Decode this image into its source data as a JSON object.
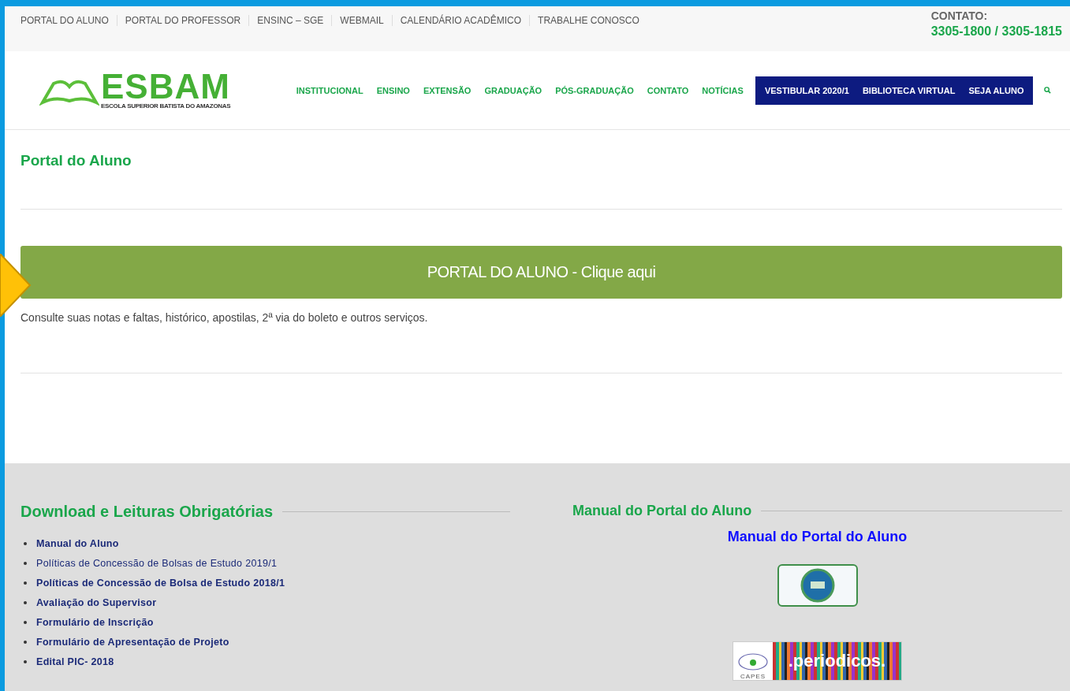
{
  "top_links": [
    "PORTAL DO ALUNO",
    "PORTAL DO PROFESSOR",
    "ENSINC – SGE",
    "WEBMAIL",
    "CALENDÁRIO ACADÊMICO",
    "TRABALHE CONOSCO"
  ],
  "contact": {
    "label": "CONTATO:",
    "phones": "3305-1800 / 3305-1815"
  },
  "logo": {
    "name": "ESBAM",
    "tagline": "ESCOLA SUPERIOR BATISTA DO AMAZONAS"
  },
  "nav": [
    {
      "label": "INSTITUCIONAL",
      "kind": "plain"
    },
    {
      "label": "ENSINO",
      "kind": "plain"
    },
    {
      "label": "EXTENSÃO",
      "kind": "plain"
    },
    {
      "label": "GRADUAÇÃO",
      "kind": "plain"
    },
    {
      "label": "PÓS-GRADUAÇÃO",
      "kind": "plain"
    },
    {
      "label": "CONTATO",
      "kind": "plain"
    },
    {
      "label": "NOTÍCIAS",
      "kind": "plain"
    },
    {
      "label": "VESTIBULAR 2020/1",
      "kind": "highlight"
    },
    {
      "label": "BIBLIOTECA VIRTUAL",
      "kind": "highlight"
    },
    {
      "label": "SEJA ALUNO",
      "kind": "highlight"
    }
  ],
  "page_title": "Portal do Aluno",
  "portal_button": "PORTAL DO ALUNO - Clique aqui",
  "description": "Consulte suas notas e faltas, histórico, apostilas, 2ª via do boleto e outros serviços.",
  "downloads": {
    "title": "Download e Leituras Obrigatórias",
    "items": [
      {
        "label": "Manual do Aluno",
        "bold": true
      },
      {
        "label": "Políticas de Concessão de Bolsas de Estudo 2019/1",
        "bold": false
      },
      {
        "label": "Políticas de Concessão de Bolsa de Estudo 2018/1",
        "bold": true
      },
      {
        "label": "Avaliação do Supervisor",
        "bold": true
      },
      {
        "label": "Formulário de Inscrição",
        "bold": true
      },
      {
        "label": "Formulário de Apresentação de Projeto",
        "bold": true
      },
      {
        "label": "Edital PIC- 2018",
        "bold": true
      }
    ]
  },
  "manual": {
    "title": "Manual do Portal do Aluno",
    "link": "Manual do Portal do Aluno",
    "periodicos": {
      "text": ".periodicos.",
      "caption": "CAPES"
    }
  }
}
